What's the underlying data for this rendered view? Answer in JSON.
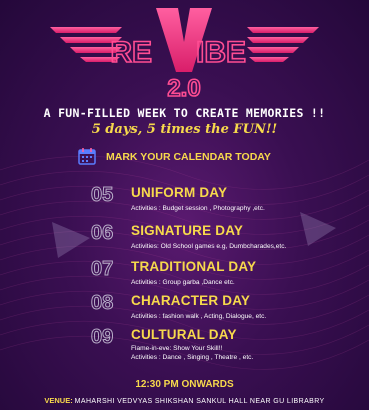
{
  "logo": {
    "left_text": "RE",
    "right_text": "IBE",
    "version": "2.0"
  },
  "tagline": "A FUN-FILLED WEEK TO CREATE MEMORIES !!",
  "subline": "5 days, 5 times the FUN!!",
  "calendar": {
    "icon": "calendar-icon",
    "text": "MARK YOUR CALENDAR TODAY"
  },
  "events": [
    {
      "num": "05",
      "title": "UNIFORM DAY",
      "lines": [
        "Activities : Budget session , Photography ,etc."
      ]
    },
    {
      "num": "06",
      "title": "SIGNATURE DAY",
      "lines": [
        "Activities: Old School games e.g, Dumbcharades,etc."
      ]
    },
    {
      "num": "07",
      "title": "TRADITIONAL DAY",
      "lines": [
        "Activities :  Group garba ,Dance etc."
      ]
    },
    {
      "num": "08",
      "title": "CHARACTER DAY",
      "lines": [
        "Activities : fashion walk , Acting, Dialogue, etc."
      ]
    },
    {
      "num": "09",
      "title": "CULTURAL DAY",
      "lines": [
        "Flame-in-eve: Show Your Skill!!",
        "Activities : Dance , Singing , Theatre , etc."
      ]
    }
  ],
  "time": "12:30 PM ONWARDS",
  "venue": {
    "label": "VENUE:",
    "text": "MAHARSHI VEDVYAS SHIKSHAN SANKUL HALL NEAR GU LIBRABRY"
  },
  "colors": {
    "accent_pink": "#e8357a",
    "accent_yellow": "#f7d94c",
    "background": "#3a0f52"
  }
}
